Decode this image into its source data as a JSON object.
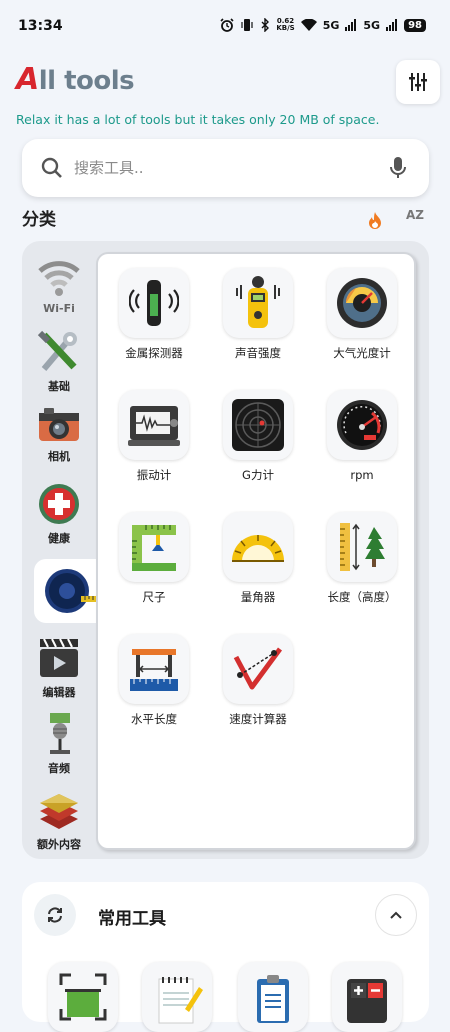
{
  "status_bar": {
    "time": "13:34",
    "net_speed_value": "0.62",
    "net_speed_unit": "KB/S",
    "signal1": "5G",
    "signal2": "5G",
    "battery": "98"
  },
  "header": {
    "title_letter": "A",
    "title_rest": "ll tools",
    "subtitle": "Relax it has a lot of tools but it takes only 20 MB of space."
  },
  "search": {
    "placeholder": "搜索工具.."
  },
  "categories": {
    "title": "分类",
    "sort_az": "AZ",
    "items": [
      {
        "label": "Wi-Fi",
        "icon": "wifi-icon"
      },
      {
        "label": "基础",
        "icon": "tools-icon"
      },
      {
        "label": "相机",
        "icon": "camera-icon"
      },
      {
        "label": "健康",
        "icon": "health-icon"
      },
      {
        "label": "",
        "icon": "tape-measure-icon",
        "active": true
      },
      {
        "label": "编辑器",
        "icon": "video-editor-icon"
      },
      {
        "label": "音频",
        "icon": "microphone-icon"
      },
      {
        "label": "额外内容",
        "icon": "extras-icon"
      }
    ]
  },
  "tools": [
    {
      "label": "金属探测器",
      "icon": "metal-detector-icon"
    },
    {
      "label": "声音强度",
      "icon": "sound-meter-icon"
    },
    {
      "label": "大气光度计",
      "icon": "light-meter-icon"
    },
    {
      "label": "振动计",
      "icon": "seismograph-icon"
    },
    {
      "label": "G力计",
      "icon": "g-force-radar-icon"
    },
    {
      "label": "rpm",
      "icon": "tachometer-icon"
    },
    {
      "label": "尺子",
      "icon": "ruler-icon"
    },
    {
      "label": "量角器",
      "icon": "protractor-icon"
    },
    {
      "label": "长度（高度）",
      "icon": "height-tree-icon"
    },
    {
      "label": "水平长度",
      "icon": "horizontal-length-icon"
    },
    {
      "label": "速度计算器",
      "icon": "speed-calculator-icon"
    }
  ],
  "frequent": {
    "title": "常用工具",
    "items": [
      {
        "icon": "scanner-icon"
      },
      {
        "icon": "notepad-icon"
      },
      {
        "icon": "clipboard-icon"
      },
      {
        "icon": "calculator-icon"
      }
    ]
  },
  "colors": {
    "background": "#f2f5fa",
    "title_gray": "#6d7f8d",
    "title_red": "#d8262e",
    "subtitle_teal": "#1d9a8b",
    "fire_orange": "#f07b22"
  }
}
